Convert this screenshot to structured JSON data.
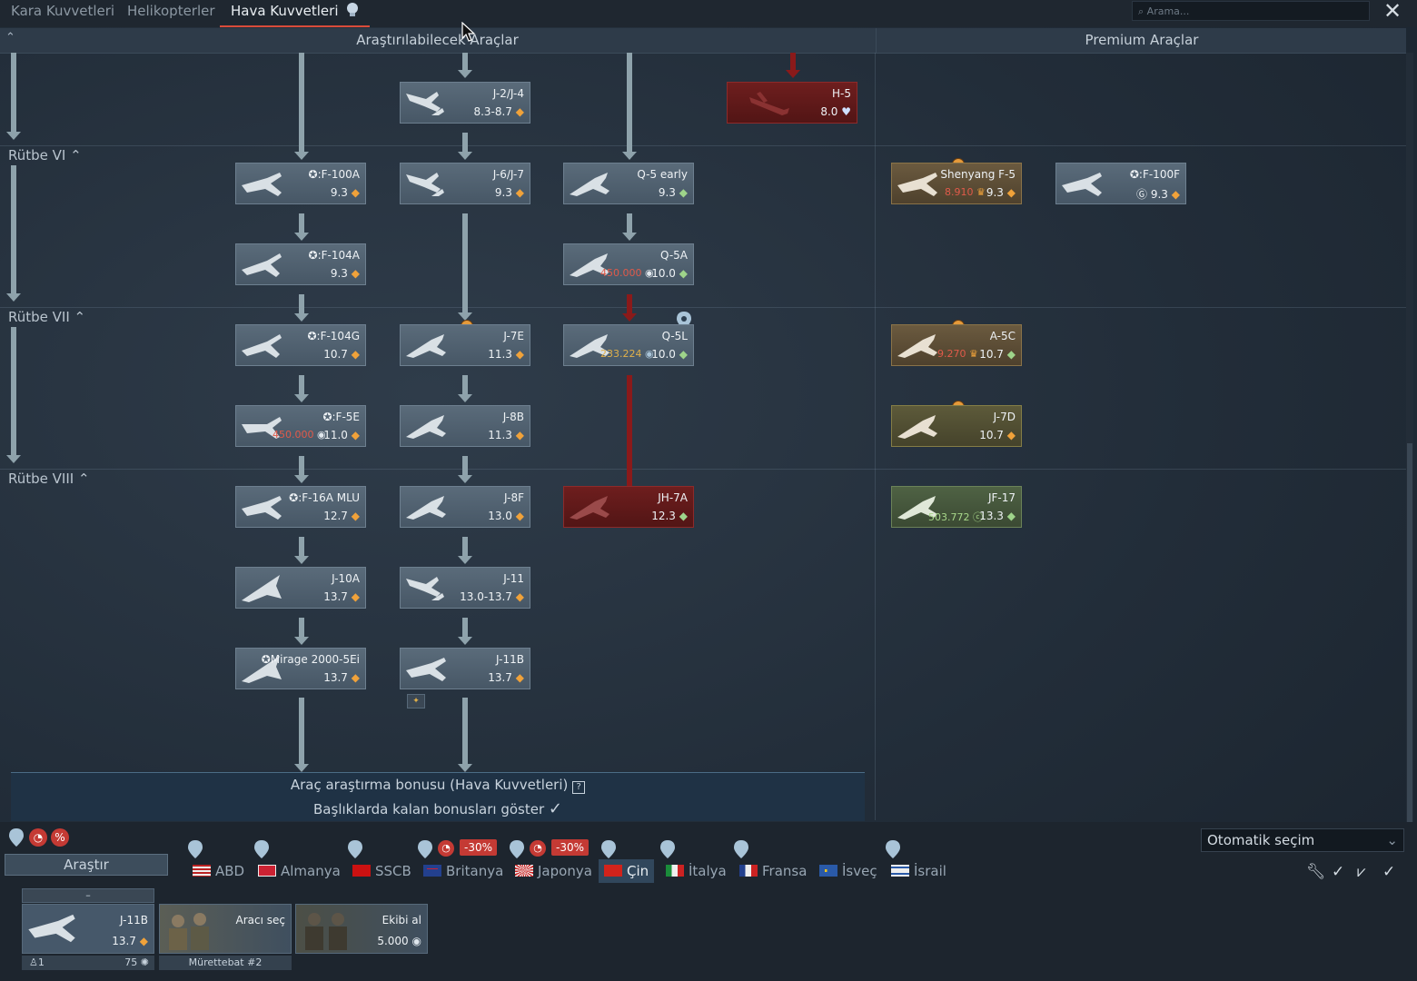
{
  "top_tabs": [
    "Kara Kuvvetleri",
    "Helikopterler",
    "Hava Kuvvetleri"
  ],
  "search_placeholder": "Arama...",
  "header": {
    "left": "Araştırılabilecek Araçlar",
    "right": "Premium Araçlar"
  },
  "ranks": [
    "Rütbe VI",
    "Rütbe VII",
    "Rütbe VIII"
  ],
  "vehicles": {
    "j2": {
      "name": "J-2/J-4",
      "br": "8.3-8.7"
    },
    "h5": {
      "name": "H-5",
      "br": "8.0"
    },
    "f100a": {
      "name": "F-100A",
      "br": "9.3"
    },
    "j6": {
      "name": "J-6/J-7",
      "br": "9.3"
    },
    "q5early": {
      "name": "Q-5 early",
      "br": "9.3"
    },
    "shenyang": {
      "name": "Shenyang F-5",
      "cost": "8.910",
      "br": "9.3"
    },
    "f100f": {
      "name": "F-100F",
      "br": "9.3"
    },
    "f104a": {
      "name": "F-104A",
      "br": "9.3"
    },
    "q5a": {
      "name": "Q-5A",
      "cost": "450.000",
      "br": "10.0"
    },
    "f104g": {
      "name": "F-104G",
      "br": "10.7"
    },
    "j7e": {
      "name": "J-7E",
      "br": "11.3"
    },
    "q5l": {
      "name": "Q-5L",
      "cost": "233.224",
      "br": "10.0"
    },
    "a5c": {
      "name": "A-5C",
      "cost": "9.270",
      "br": "10.7"
    },
    "f5e": {
      "name": "F-5E",
      "cost": "450.000",
      "br": "11.0"
    },
    "j8b": {
      "name": "J-8B",
      "br": "11.3"
    },
    "j7d": {
      "name": "J-7D",
      "br": "10.7"
    },
    "f16a": {
      "name": "F-16A MLU",
      "br": "12.7"
    },
    "j8f": {
      "name": "J-8F",
      "br": "13.0"
    },
    "jh7a": {
      "name": "JH-7A",
      "br": "12.3"
    },
    "jf17": {
      "name": "JF-17",
      "cost": "503.772",
      "br": "13.3"
    },
    "j10a": {
      "name": "J-10A",
      "br": "13.7"
    },
    "j11": {
      "name": "J-11",
      "br": "13.0-13.7"
    },
    "mirage": {
      "name": "Mirage 2000-5Ei",
      "br": "13.7"
    },
    "j11b": {
      "name": "J-11B",
      "br": "13.7"
    }
  },
  "bonus": {
    "line1": "Araç araştırma bonusu (Hava Kuvvetleri)",
    "line2": "Başlıklarda kalan bonusları göster"
  },
  "research_button": "Araştır",
  "discounts": [
    "-30%",
    "-30%"
  ],
  "nations": [
    {
      "name": "ABD",
      "active": false
    },
    {
      "name": "Almanya",
      "active": false
    },
    {
      "name": "SSCB",
      "active": false
    },
    {
      "name": "Britanya",
      "active": false
    },
    {
      "name": "Japonya",
      "active": false
    },
    {
      "name": "Çin",
      "active": true
    },
    {
      "name": "İtalya",
      "active": false
    },
    {
      "name": "Fransa",
      "active": false
    },
    {
      "name": "İsveç",
      "active": false
    },
    {
      "name": "İsrail",
      "active": false
    }
  ],
  "auto_select": "Otomatik seçim",
  "crew": {
    "slot_top": "–",
    "vehicle_name": "J-11B",
    "vehicle_br": "13.7",
    "slot_count": "1",
    "slot_level": "75",
    "crew_label": "Mürettebat #2",
    "select_vehicle": "Aracı seç",
    "get_crew": "Ekibi al",
    "get_crew_cost": "5.000"
  },
  "colors": {
    "accent": "#d94b3a",
    "premium": "#6b5a3f",
    "locked": "#6e1e1e",
    "rp": "#f0a23a"
  }
}
